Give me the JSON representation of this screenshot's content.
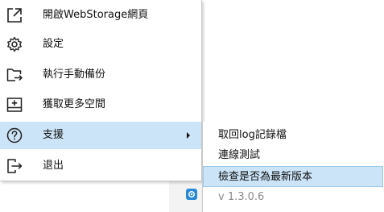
{
  "menu": {
    "items": [
      {
        "label": "開啟WebStorage網頁",
        "icon": "open-external-icon"
      },
      {
        "label": "設定",
        "icon": "gear-icon"
      },
      {
        "label": "執行手動備份",
        "icon": "folder-backup-icon"
      },
      {
        "label": "獲取更多空間",
        "icon": "storage-add-icon"
      },
      {
        "label": "支援",
        "icon": "help-circle-icon",
        "has_submenu": true
      },
      {
        "label": "退出",
        "icon": "exit-icon"
      }
    ]
  },
  "submenu": {
    "items": [
      {
        "label": "取回log記錄檔"
      },
      {
        "label": "連線測試"
      },
      {
        "label": "檢查是否為最新版本"
      },
      {
        "label": "v 1.3.0.6"
      }
    ]
  },
  "colors": {
    "highlight": "#cce4f7",
    "highlight_border": "#99c9ef",
    "icon_stroke": "#1f1f1f",
    "tray_icon": "#2a8ad8"
  }
}
